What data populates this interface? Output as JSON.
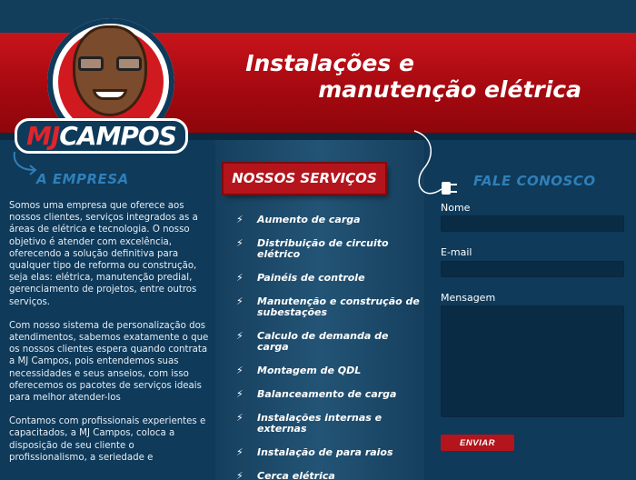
{
  "header": {
    "logo_text_mj": "MJ",
    "logo_text_rest": "CAMPOS",
    "tagline_line1": "Instalações e",
    "tagline_line2": "manutenção elétrica"
  },
  "empresa": {
    "title": "A EMPRESA",
    "paragraphs": [
      "Somos uma empresa que oferece aos nossos clientes, serviços integrados as a áreas de elétrica e tecnologia. O nosso objetivo é atender com excelência, oferecendo a solução definitiva para qualquer tipo de reforma ou construção, seja elas: elétrica, manutenção predial, gerenciamento de projetos, entre outros serviços.",
      "Com nosso sistema de personalização dos atendimentos, sabemos exatamente o que os nossos clientes espera quando contrata a MJ Campos, pois entendemos suas necessidades e seus anseios, com isso oferecemos os pacotes de serviços ideais para melhor atender-los",
      "Contamos com profissionais experientes e capacitados, a MJ Campos, coloca a disposição de seu cliente o profissionalismo, a seriedade e"
    ]
  },
  "services": {
    "title": "NOSSOS SERVIÇOS",
    "items": [
      "Aumento de carga",
      "Distribuição de circuito elétrico",
      "Painéis de controle",
      "Manutenção e construção de subestações",
      "Calculo de demanda de carga",
      "Montagem de QDL",
      "Balanceamento de carga",
      "Instalações internas e externas",
      "Instalação de para raios",
      "Cerca elétrica"
    ]
  },
  "contact": {
    "title": "FALE CONOSCO",
    "name_label": "Nome",
    "email_label": "E-mail",
    "message_label": "Mensagem",
    "send_label": "ENVIAR"
  },
  "colors": {
    "brand_red": "#b4141b",
    "background_blue": "#0f3a5a",
    "title_blue": "#2f7fb8"
  }
}
